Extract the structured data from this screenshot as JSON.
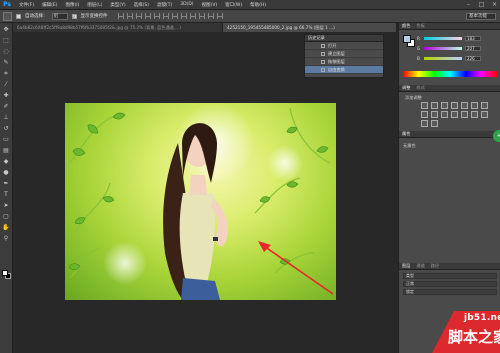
{
  "app": {
    "logo": "Ps"
  },
  "menu": [
    "文件(F)",
    "编辑(E)",
    "图像(I)",
    "图层(L)",
    "类型(Y)",
    "选择(S)",
    "滤镜(T)",
    "3D(D)",
    "视图(V)",
    "窗口(W)",
    "帮助(H)"
  ],
  "window_controls": {
    "minimize": "–",
    "maximize": "□",
    "close": "×"
  },
  "options": {
    "auto_select_label": "自动选择：",
    "auto_select_value": "组",
    "show_transform_label": "显示变换控件",
    "show_transform_checked": "✓",
    "workspace": "基本功能"
  },
  "tabs": [
    {
      "label": "6a4b82c6/t8ff2c5ff9a8d98b57f6fb3375085f2&.jpg @ 75.2% (背景, 蓝色通道... )",
      "active": false
    },
    {
      "label": "4252150_195455485000_2.jpg @ 66.7% (图层 1 ...)",
      "active": true
    }
  ],
  "history": {
    "tab": "历史记录",
    "items": [
      {
        "label": "打开",
        "active": false
      },
      {
        "label": "建立图层",
        "active": false
      },
      {
        "label": "拖移图层",
        "active": false
      },
      {
        "label": "自由变换",
        "active": true
      }
    ]
  },
  "color_panel": {
    "tabs": [
      "颜色",
      "色板"
    ],
    "sliders": [
      {
        "label": "R",
        "value": "183"
      },
      {
        "label": "G",
        "value": "207"
      },
      {
        "label": "B",
        "value": "226"
      }
    ],
    "fg": "#b9cbe6",
    "bg": "#ffffff"
  },
  "adjust_panel": {
    "tabs": [
      "调整",
      "样式"
    ],
    "title": "添加调整"
  },
  "props_panel": {
    "tabs": [
      "属性"
    ],
    "label": "无属性"
  },
  "layers_panel": {
    "tabs": [
      "图层",
      "通道",
      "路径"
    ],
    "rows": [
      "类型",
      "正常",
      "锁定"
    ]
  },
  "side_button": {
    "label": "+"
  },
  "watermark": {
    "url": "jb51.net",
    "name": "脚本之家"
  },
  "colors": {
    "accent": "#5d7aa1",
    "arrow": "#e8262b",
    "canvas_bg": "#282828"
  }
}
